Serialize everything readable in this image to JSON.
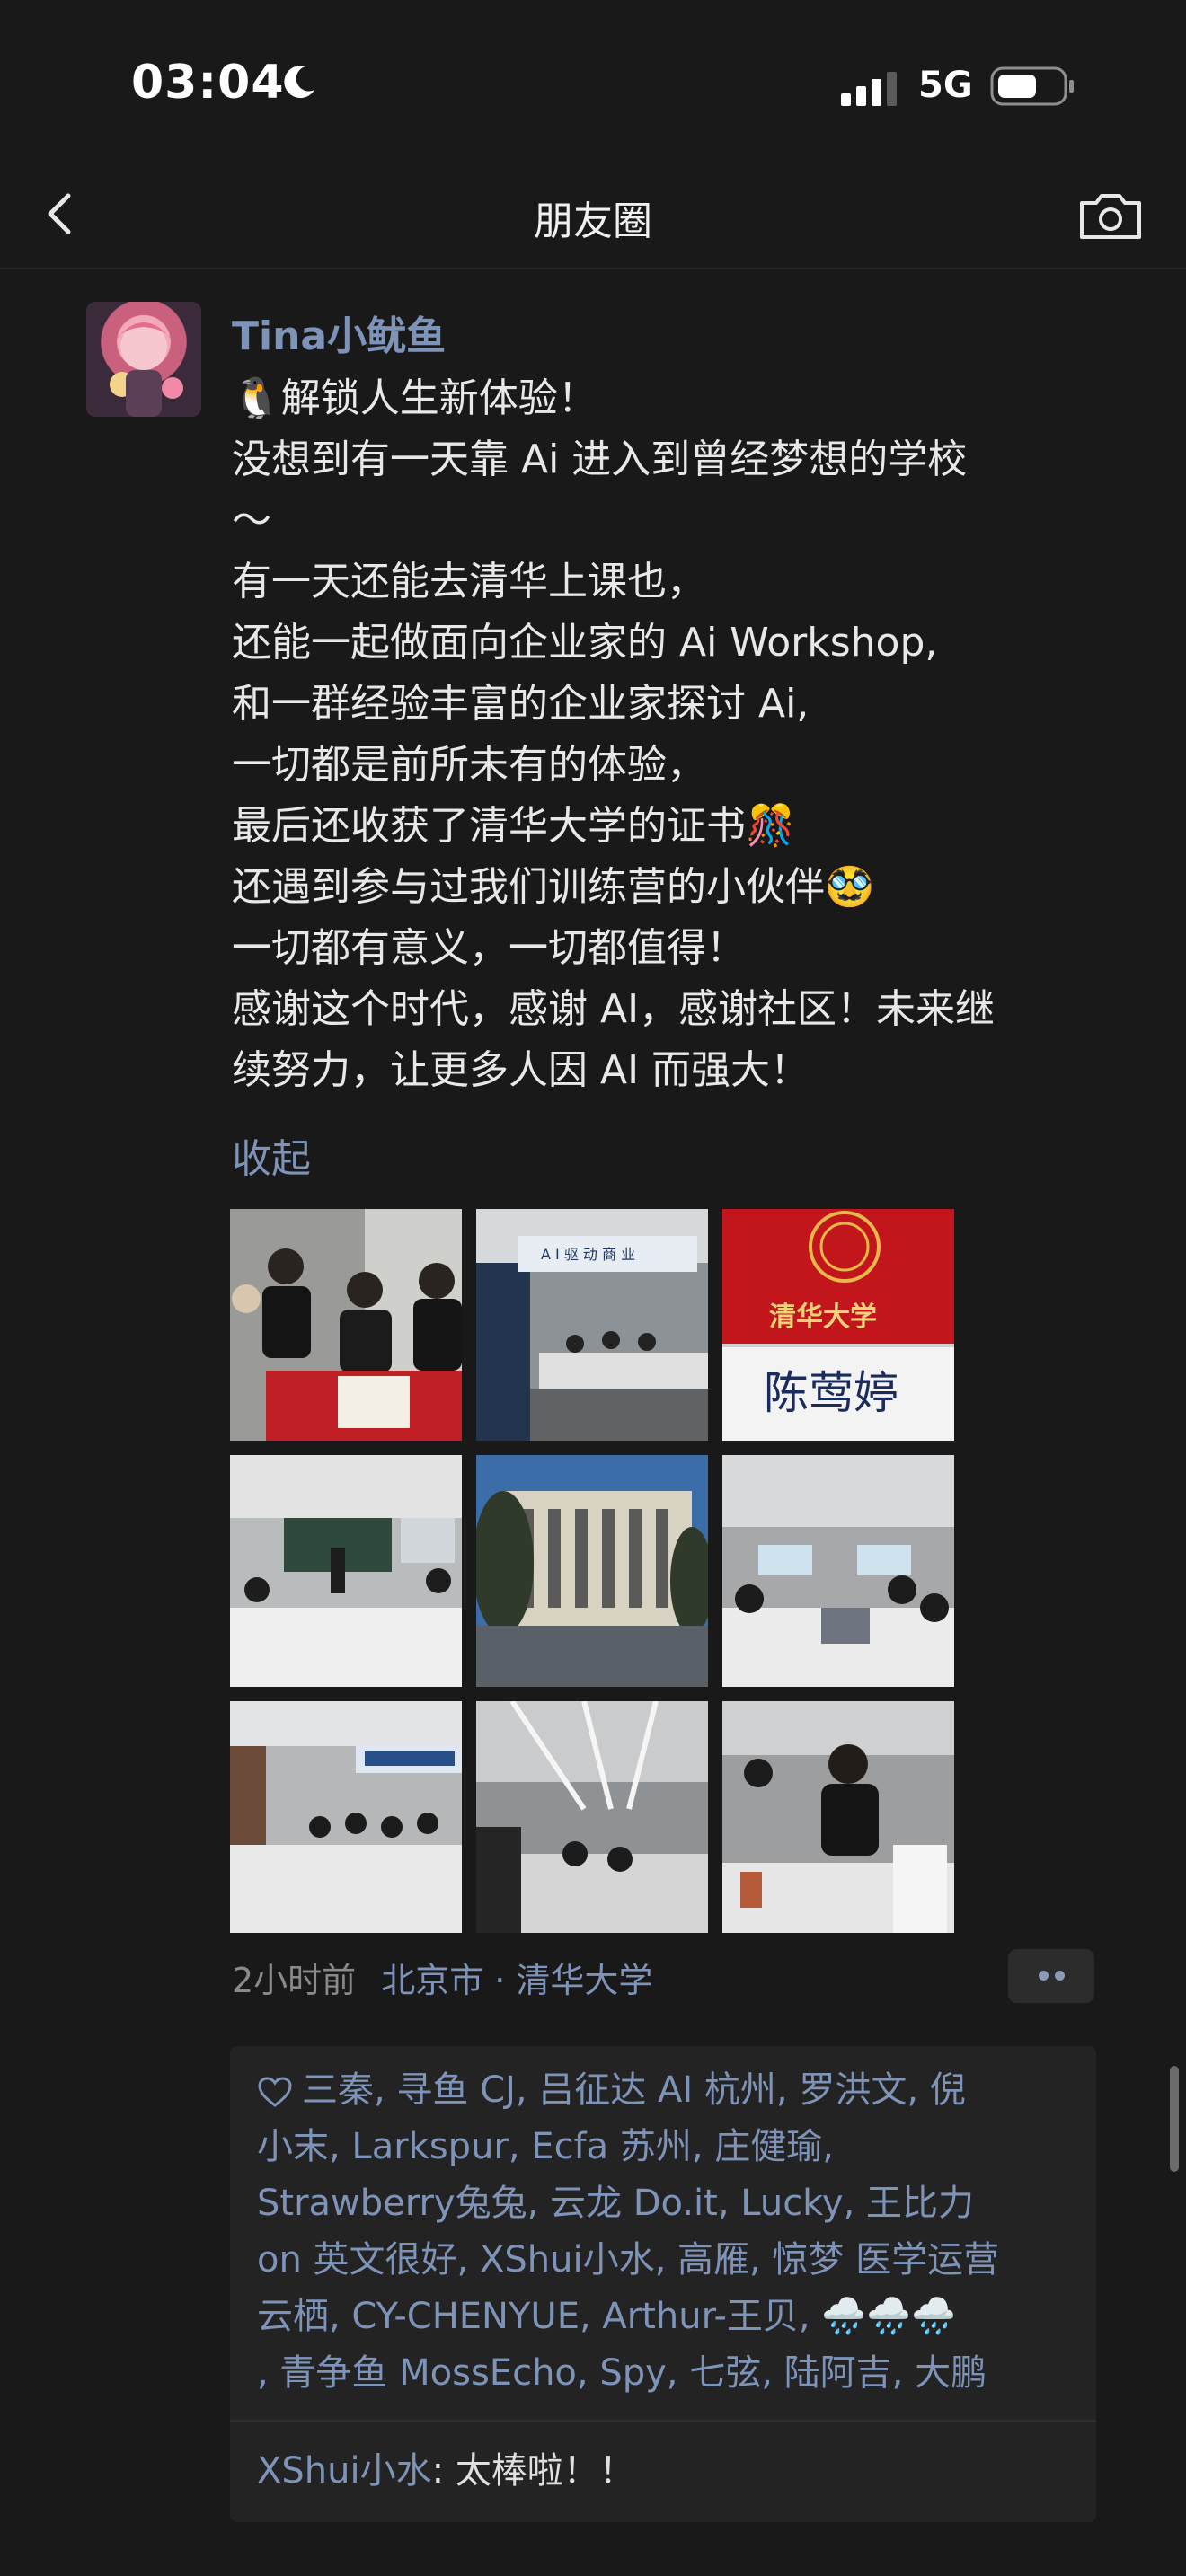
{
  "status": {
    "time": "03:04",
    "network": "5G"
  },
  "nav": {
    "title": "朋友圈"
  },
  "post": {
    "username": "Tina小鱿鱼",
    "lines": [
      "🐧解锁人生新体验！",
      "没想到有一天靠 Ai 进入到曾经梦想的学校",
      "～",
      "有一天还能去清华上课也，",
      "还能一起做面向企业家的 Ai Workshop,",
      "和一群经验丰富的企业家探讨 Ai,",
      "一切都是前所未有的体验，",
      "最后还收获了清华大学的证书🎊",
      "还遇到参与过我们训练营的小伙伴🥸",
      "一切都有意义，一切都值得！",
      "感谢这个时代，感谢 AI，感谢社区！未来继",
      "续努力，让更多人因 AI 而强大！"
    ],
    "collapse_label": "收起",
    "photos": [
      {
        "name": "photo-group-certificate"
      },
      {
        "name": "photo-workshop-room"
      },
      {
        "name": "photo-name-card",
        "card_text": "陈莺婷",
        "header_text": "清华大学"
      },
      {
        "name": "photo-lecture"
      },
      {
        "name": "photo-building"
      },
      {
        "name": "photo-classroom"
      },
      {
        "name": "photo-ai-banner"
      },
      {
        "name": "photo-hall"
      },
      {
        "name": "photo-discussion"
      }
    ],
    "time_ago": "2小时前",
    "location": "北京市 · 清华大学"
  },
  "likes": {
    "lines": [
      "三秦, 寻鱼 CJ, 吕征达 AI 杭州, 罗洪文, 倪",
      "小末, Larkspur, Ecfa 苏州, 庄健瑜,",
      "Strawberry兔兔, 云龙 Do.it, Lucky, 王比力",
      "on 英文很好, XShui小水, 高雁, 惊梦 医学运营",
      "云栖, CY-CHENYUE, Arthur-王贝, 🌧️🌧️🌧️",
      ", 青争鱼 MossEcho, Spy, 七弦, 陆阿吉, 大鹏"
    ]
  },
  "comments": [
    {
      "author": "XShui小水",
      "sep": ": ",
      "text": "太棒啦！！"
    }
  ],
  "colors": {
    "background": "#191919",
    "link": "#7e93b8",
    "panel": "#232323"
  }
}
